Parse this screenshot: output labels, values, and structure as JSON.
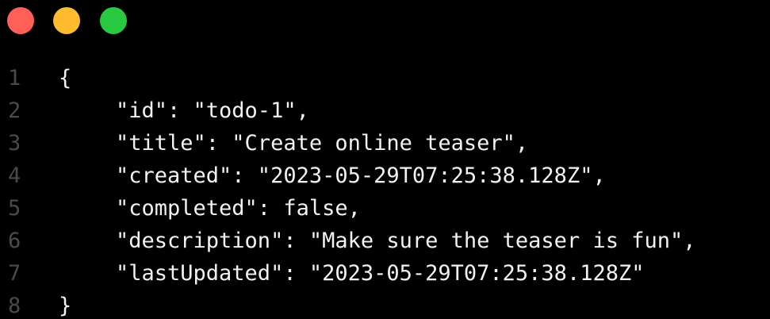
{
  "window": {
    "traffic_lights": {
      "close": "#ff5f57",
      "minimize": "#febc2e",
      "maximize": "#28c840"
    }
  },
  "editor": {
    "lines": [
      {
        "number": "1",
        "text": "{"
      },
      {
        "number": "2",
        "text": "\"id\": \"todo-1\","
      },
      {
        "number": "3",
        "text": "\"title\": \"Create online teaser\","
      },
      {
        "number": "4",
        "text": "\"created\": \"2023-05-29T07:25:38.128Z\","
      },
      {
        "number": "5",
        "text": "\"completed\": false,"
      },
      {
        "number": "6",
        "text": "\"description\": \"Make sure the teaser is fun\","
      },
      {
        "number": "7",
        "text": "\"lastUpdated\": \"2023-05-29T07:25:38.128Z\""
      },
      {
        "number": "8",
        "text": "}"
      }
    ]
  }
}
